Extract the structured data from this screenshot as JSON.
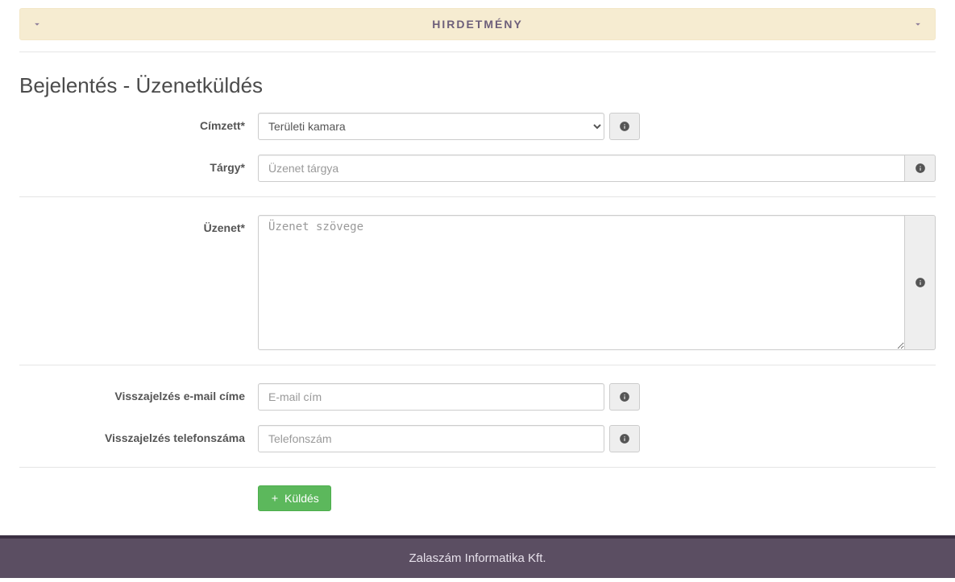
{
  "banner": {
    "title": "HIRDETMÉNY"
  },
  "page_title": "Bejelentés - Üzenetküldés",
  "form": {
    "recipient": {
      "label": "Címzett*",
      "selected": "Területi kamara"
    },
    "subject": {
      "label": "Tárgy*",
      "placeholder": "Üzenet tárgya",
      "value": ""
    },
    "message": {
      "label": "Üzenet*",
      "placeholder": "Üzenet szövege",
      "value": ""
    },
    "feedback_email": {
      "label": "Visszajelzés e-mail címe",
      "placeholder": "E-mail cím",
      "value": ""
    },
    "feedback_phone": {
      "label": "Visszajelzés telefonszáma",
      "placeholder": "Telefonszám",
      "value": ""
    },
    "submit_label": "Küldés"
  },
  "footer": {
    "text": "Zalaszám Informatika Kft."
  }
}
